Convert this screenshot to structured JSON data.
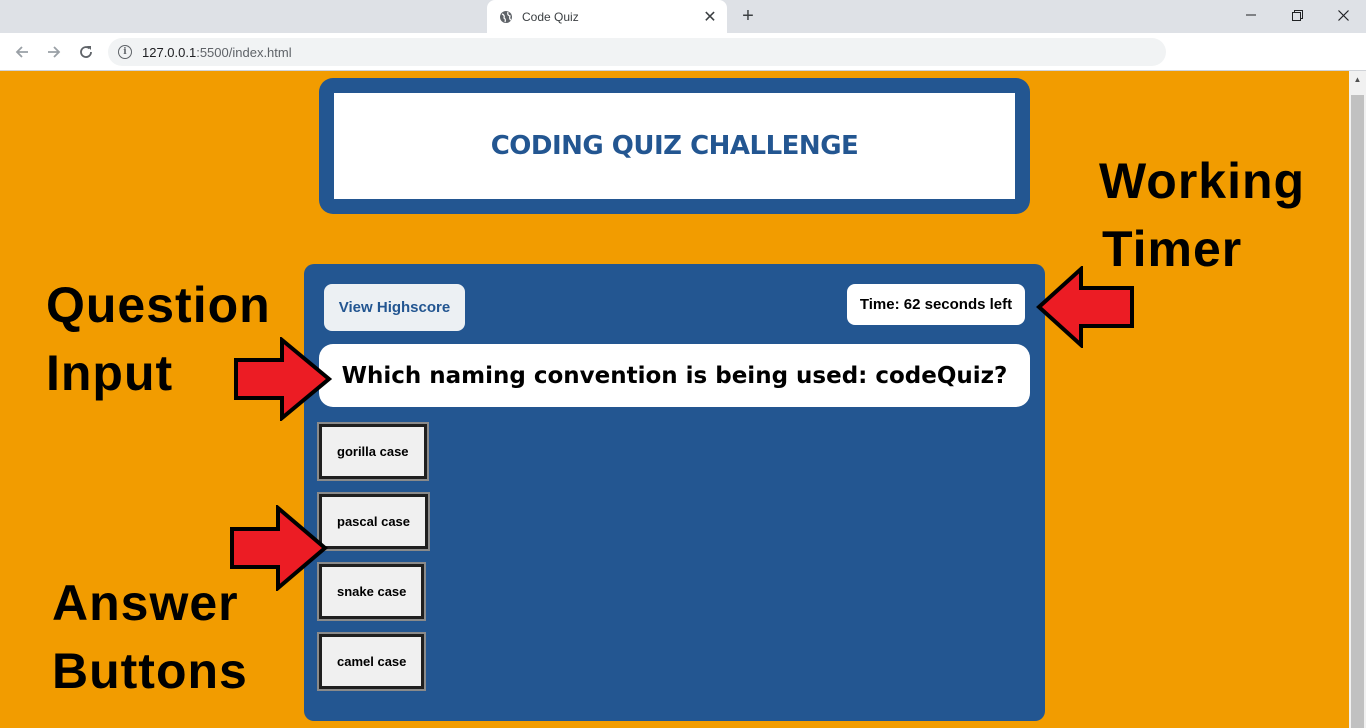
{
  "browser": {
    "tab_title": "Code Quiz",
    "new_tab_symbol": "+",
    "url_host": "127.0.0.1",
    "url_rest": ":5500/index.html"
  },
  "page": {
    "header_title": "CODING QUIZ CHALLENGE",
    "highscore_label": "View Highscore",
    "timer_text": "Time: 62 seconds left",
    "question": "Which naming convention is being used: codeQuiz?",
    "answers": [
      "gorilla case",
      "pascal case",
      "snake case",
      "camel case"
    ]
  },
  "annotations": {
    "working": "Working",
    "timer": "Timer",
    "question": "Question",
    "input": "Input",
    "answer": "Answer",
    "buttons": "Buttons"
  },
  "colors": {
    "page_background": "#f29c00",
    "card_blue": "#235691",
    "arrow_red": "#ec1c24"
  }
}
